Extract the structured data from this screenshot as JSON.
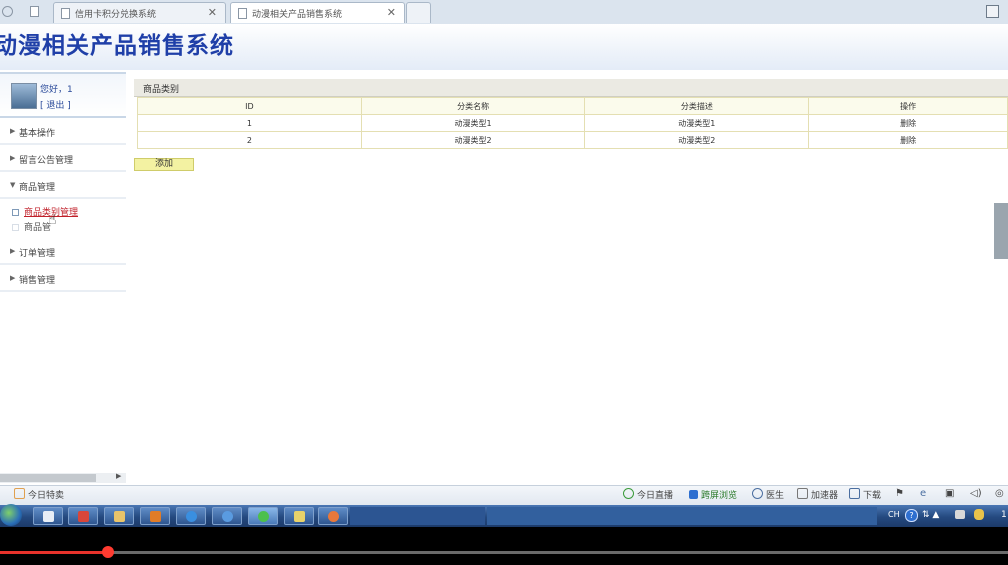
{
  "browser": {
    "tabs": [
      {
        "title": "信用卡积分兑换系统",
        "close": "✕",
        "active": false
      },
      {
        "title": "动漫相关产品销售系统",
        "close": "✕",
        "active": true
      }
    ]
  },
  "header": {
    "title": "动漫相关产品销售系统"
  },
  "sidebar": {
    "greeting": "您好，1",
    "logout": "[ 退出 ]",
    "menus": [
      {
        "label": "基本操作",
        "arrow": "▶"
      },
      {
        "label": "留言公告管理",
        "arrow": "▶"
      },
      {
        "label": "商品管理",
        "arrow": "▼"
      },
      {
        "label": "订单管理",
        "arrow": "▶"
      },
      {
        "label": "销售管理",
        "arrow": "▶"
      }
    ],
    "submenu": [
      {
        "label": "商品类别管理",
        "active": true
      },
      {
        "label": "商品管",
        "active": false
      }
    ]
  },
  "content": {
    "panel_title": "商品类别",
    "columns": [
      "ID",
      "分类名称",
      "分类描述",
      "操作"
    ],
    "rows": [
      {
        "id": "1",
        "name": "动漫类型1",
        "desc": "动漫类型1",
        "action": "删除"
      },
      {
        "id": "2",
        "name": "动漫类型2",
        "desc": "动漫类型2",
        "action": "删除"
      }
    ],
    "add_button": "添加"
  },
  "statusbar": {
    "today_deal": "今日特卖",
    "today_live": "今日直播",
    "split_browse": "跨屏浏览",
    "doctor": "医生",
    "accelerator": "加速器",
    "download": "下载"
  },
  "taskbar": {
    "lang": "CH",
    "help": "?",
    "tray_symbols": "⇅ ▲",
    "clock": "1"
  },
  "player": {
    "progress_fraction": 0.107
  },
  "colors": {
    "title_blue": "#1f3fa8",
    "active_link": "#c0202a",
    "add_button_bg": "#f3f2a2",
    "progress_red": "#e8322b"
  }
}
